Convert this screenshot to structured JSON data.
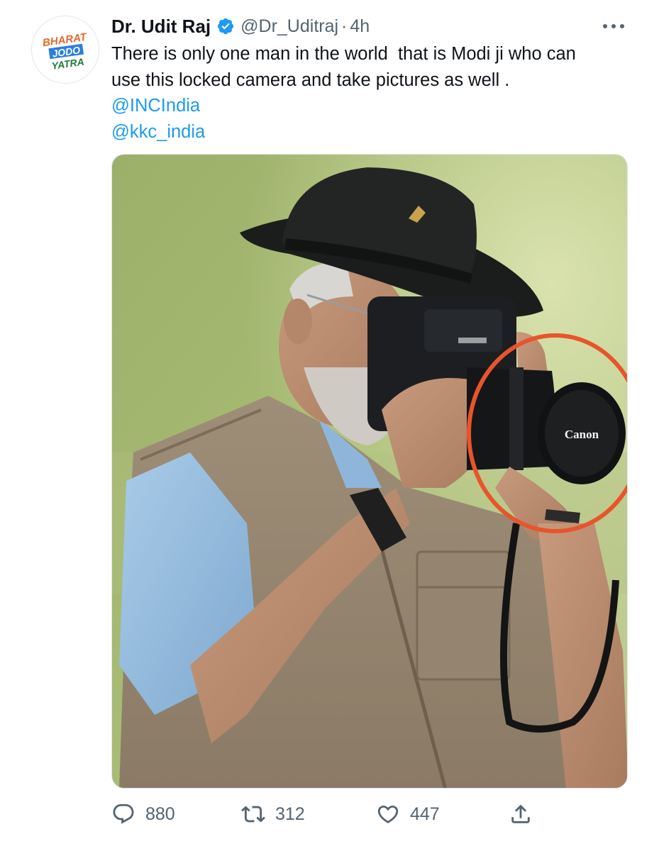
{
  "author": {
    "display_name": "Dr. Udit Raj",
    "handle": "@Dr_Uditraj",
    "separator": "·",
    "time": "4h",
    "verified": true,
    "avatar_logo_lines": [
      "BHARAT",
      "JODO",
      "YATRA"
    ]
  },
  "tweet": {
    "text_lines": [
      "There is only one man in the world  that is Modi ji who can",
      "use this locked camera and take pictures as well ."
    ],
    "mentions": [
      "@INCIndia",
      "@kkc_india"
    ],
    "media": {
      "lens_cap_text": "Canon"
    }
  },
  "actions": {
    "replies": "880",
    "retweets": "312",
    "likes": "447"
  },
  "colors": {
    "link": "#1d9bf0",
    "secondary_text": "#536471",
    "verified": "#1d9bf0",
    "annotation_circle": "#e8542c"
  },
  "icons": [
    "verified-badge-icon",
    "more-options-icon",
    "reply-icon",
    "retweet-icon",
    "like-icon",
    "share-icon"
  ]
}
